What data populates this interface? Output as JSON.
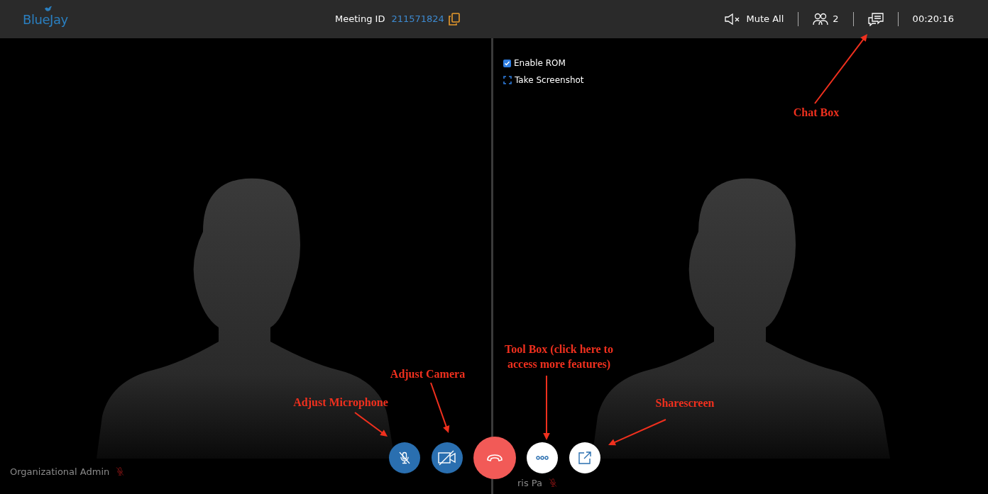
{
  "header": {
    "logo": "BlueJay",
    "meeting_id_label": "Meeting ID",
    "meeting_id": "211571824",
    "mute_all": "Mute All",
    "participant_count": "2",
    "timer": "00:20:16"
  },
  "overlay_options": [
    {
      "kind": "checkbox",
      "label": "Enable ROM",
      "checked": true
    },
    {
      "kind": "action",
      "label": "Take Screenshot"
    }
  ],
  "participants": [
    {
      "name": "Organizational Admin",
      "muted": true
    },
    {
      "name": "ris Pa",
      "muted": true
    }
  ],
  "controls": [
    {
      "kind": "mic"
    },
    {
      "kind": "camera"
    },
    {
      "kind": "hangup"
    },
    {
      "kind": "more"
    },
    {
      "kind": "share"
    }
  ],
  "annotations": [
    "Chat Box",
    "Adjust Camera",
    "Adjust Microphone",
    "Tool Box (click here to access more features)",
    "Sharescreen"
  ]
}
